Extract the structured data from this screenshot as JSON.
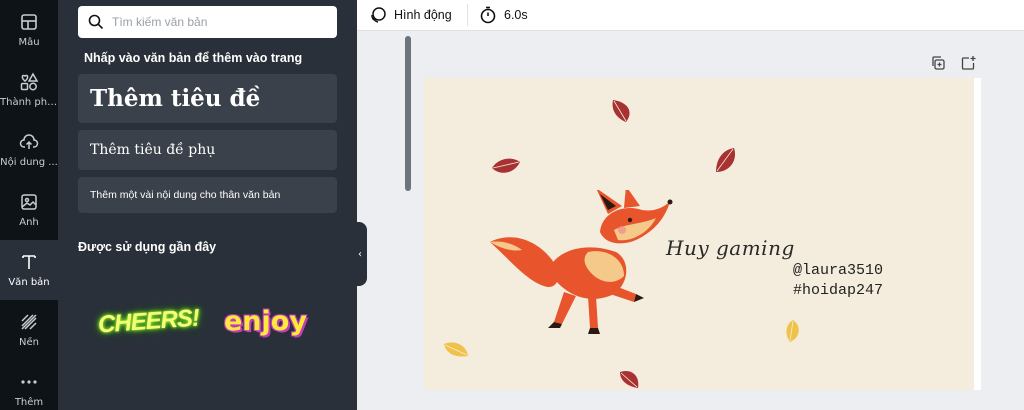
{
  "sidebar": {
    "items": [
      {
        "label": "Mẫu",
        "icon": "layout-icon",
        "active": false
      },
      {
        "label": "Thành phần",
        "icon": "elements-icon",
        "active": false
      },
      {
        "label": "Nội dung ...",
        "icon": "upload-cloud-icon",
        "active": false
      },
      {
        "label": "Ảnh",
        "icon": "image-icon",
        "active": false
      },
      {
        "label": "Văn bản",
        "icon": "text-icon",
        "active": true
      },
      {
        "label": "Nền",
        "icon": "background-pattern-icon",
        "active": false
      },
      {
        "label": "Thêm",
        "icon": "more-dots-icon",
        "active": false
      }
    ]
  },
  "text_panel": {
    "search_placeholder": "Tìm kiếm văn bản",
    "section_title": "Nhấp vào văn bản để thêm vào trang",
    "add_heading": "Thêm tiêu đề",
    "add_subheading": "Thêm tiêu đề phụ",
    "add_body": "Thêm một vài nội dung cho thân văn bản",
    "recent_title": "Được sử dụng gần đây",
    "recent_stickers": [
      "CHEERS!",
      "enjoy"
    ]
  },
  "toolbar": {
    "animation_label": "Hình động",
    "duration_label": "6.0s"
  },
  "canvas": {
    "title_text": "Huy gaming",
    "handle_text": "@laura3510",
    "hashtag_text": "#hoidap247",
    "background_color": "#f4ecdc"
  },
  "colors": {
    "rail_bg": "#0e1318",
    "panel_bg": "#293039",
    "button_bg": "#3a414a",
    "fox_orange": "#e8542c",
    "leaf_red": "#a83232",
    "leaf_yellow": "#f0c24a"
  }
}
